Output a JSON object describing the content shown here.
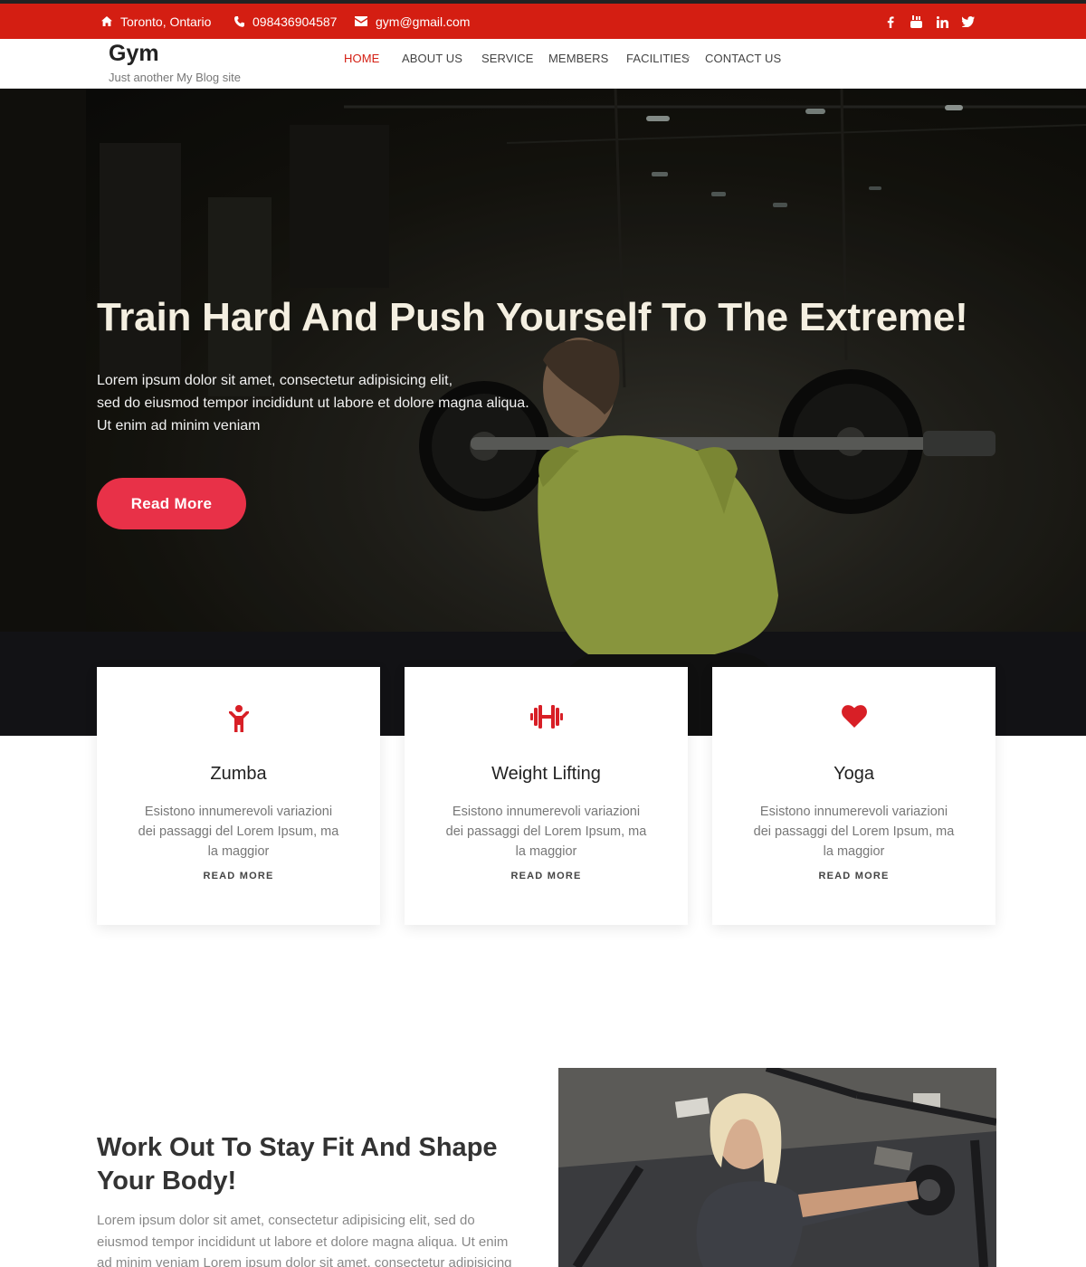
{
  "topbar": {
    "location": "Toronto, Ontario",
    "phone": "098436904587",
    "email": "gym@gmail.com",
    "social": [
      "facebook-icon",
      "youtube-icon",
      "linkedin-icon",
      "twitter-icon"
    ]
  },
  "header": {
    "site_title": "Gym",
    "tagline": "Just another My Blog site",
    "nav": [
      "HOME",
      "ABOUT US",
      "SERVICE",
      "MEMBERS",
      "FACILITIES",
      "CONTACT US"
    ]
  },
  "hero": {
    "title": "Train Hard And Push Yourself To The Extreme!",
    "text": [
      "Lorem ipsum dolor sit amet, consectetur adipisicing elit,",
      "sed do eiusmod tempor incididunt ut labore et dolore magna aliqua.",
      "Ut enim ad minim veniam"
    ],
    "button": "Read More"
  },
  "cards": [
    {
      "icon": "person-icon",
      "title": "Zumba",
      "text": [
        "Esistono innumerevoli variazioni",
        "dei passaggi del Lorem Ipsum, ma",
        "la maggior"
      ],
      "more": "READ MORE"
    },
    {
      "icon": "dumbbell-icon",
      "title": "Weight Lifting",
      "text": [
        "Esistono innumerevoli variazioni",
        "dei passaggi del Lorem Ipsum, ma",
        "la maggior"
      ],
      "more": "READ MORE"
    },
    {
      "icon": "heart-icon",
      "title": "Yoga",
      "text": [
        "Esistono innumerevoli variazioni",
        "dei passaggi del Lorem Ipsum, ma",
        "la maggior"
      ],
      "more": "READ MORE"
    }
  ],
  "about": {
    "title_lines": [
      "Work Out To Stay Fit And Shape",
      "Your Body!"
    ],
    "text_lines": [
      "Lorem ipsum dolor sit amet, consectetur adipisicing elit, sed do",
      "eiusmod tempor incididunt ut labore et dolore magna aliqua. Ut enim",
      "ad minim veniam Lorem ipsum dolor sit amet, consectetur adipisicing"
    ]
  },
  "colors": {
    "brand_red": "#d41e12",
    "button_pink": "#e83148",
    "icon_red": "#d81f26"
  }
}
